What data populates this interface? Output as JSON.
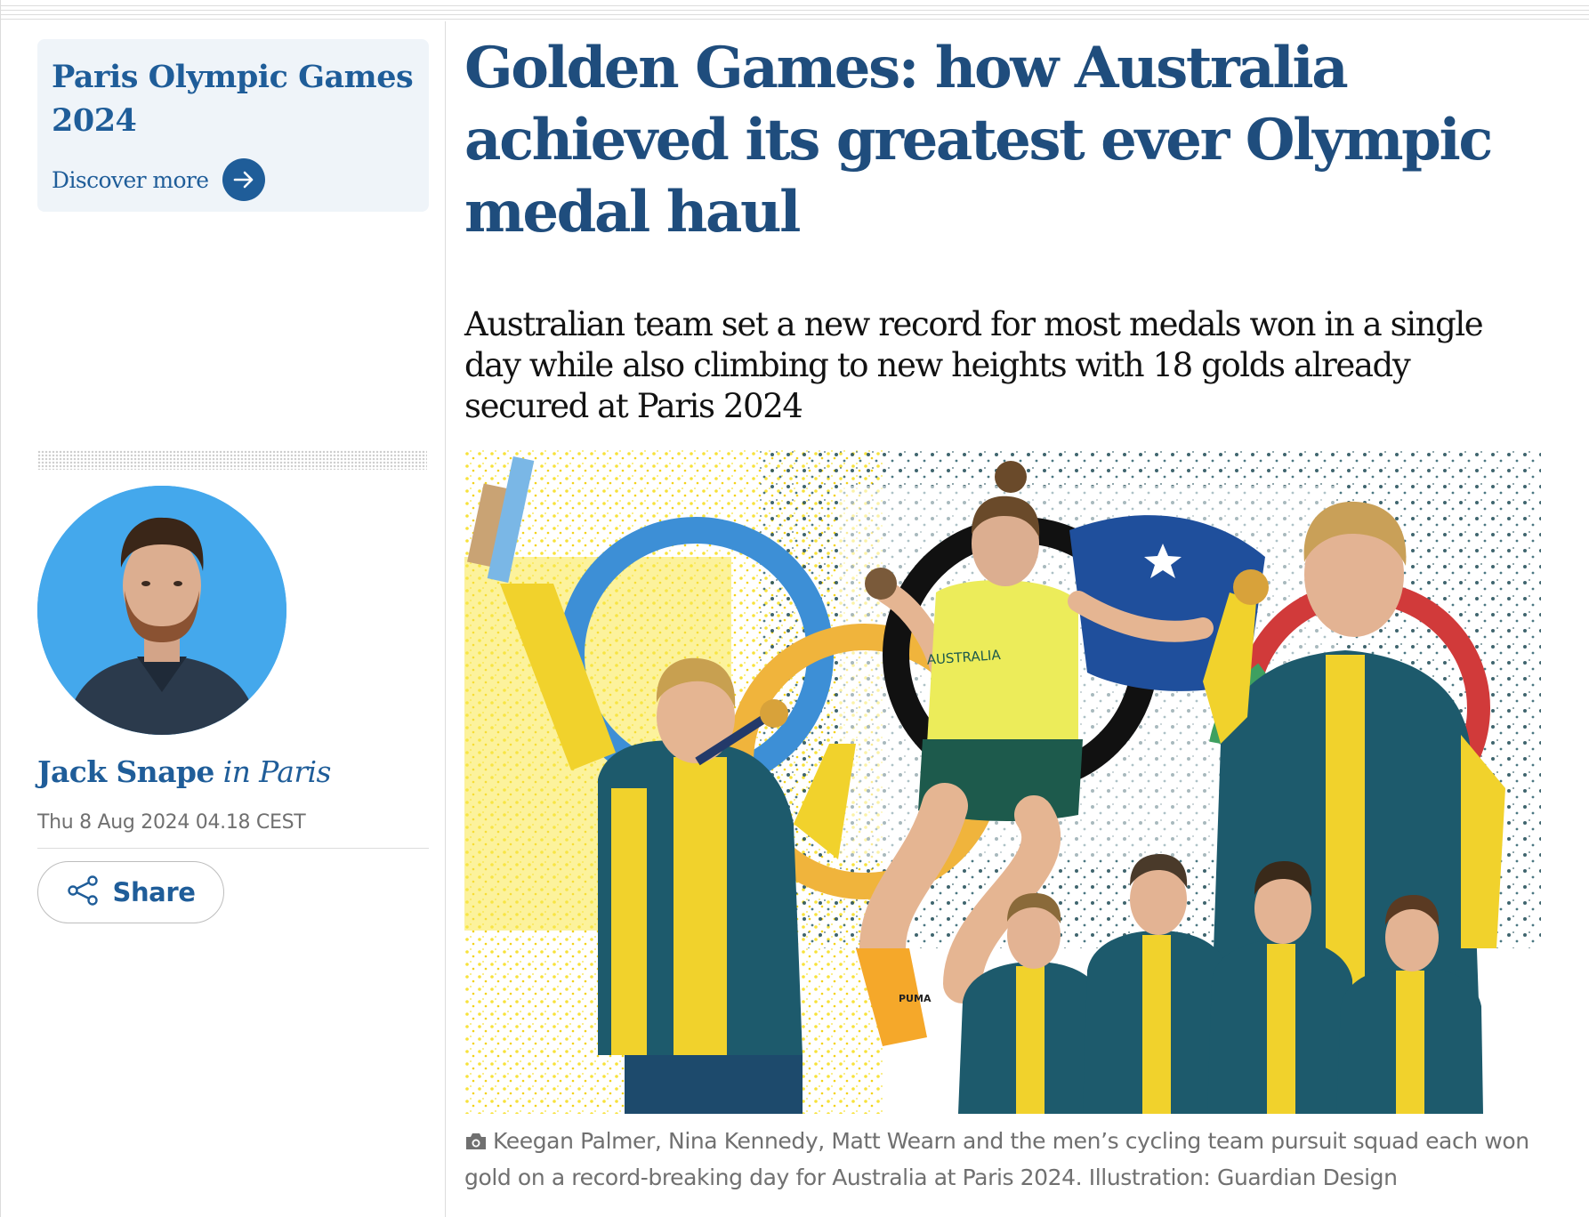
{
  "promo": {
    "title": "Paris Olympic Games 2024",
    "link_label": "Discover more",
    "icon": "arrow-right-icon",
    "colors": {
      "background": "#eff4f9",
      "text": "#1f5d99"
    }
  },
  "author": {
    "name": "Jack Snape",
    "location": "in Paris",
    "avatar_background": "#44a8ec"
  },
  "dateline": "Thu 8 Aug 2024 04.18 CEST",
  "share": {
    "label": "Share",
    "icon": "share-icon"
  },
  "article": {
    "headline": "Golden Games: how Australia achieved its greatest ever Olympic medal haul",
    "standfirst": "Australian team set a new record for most medals won in a single day while also climbing to new heights with 18 golds already secured at Paris 2024",
    "hero_image": {
      "jersey_text": "AUSTRALIA",
      "shoe_text": "PUMA"
    },
    "caption": {
      "icon": "camera-icon",
      "text": "Keegan Palmer, Nina Kennedy, Matt Wearn and the men’s cycling team pursuit squad each won gold on a record-breaking day for Australia at Paris 2024. Illustration: Guardian Design"
    }
  },
  "colors": {
    "headline": "#1f4d7d",
    "accent": "#1f5d99",
    "meta": "#707070"
  }
}
